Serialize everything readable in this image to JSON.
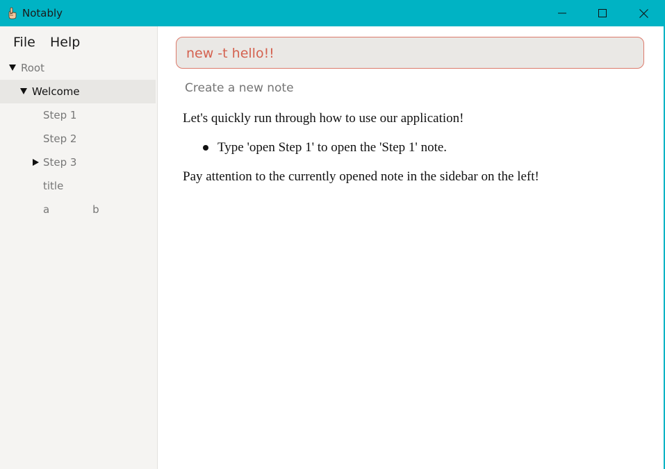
{
  "window": {
    "title": "Notably",
    "app_icon": "hand-pointer-icon",
    "accent_color": "#00b3c4"
  },
  "menu": {
    "file": "File",
    "help": "Help"
  },
  "tree": {
    "root": "Root",
    "welcome": "Welcome",
    "step1": "Step 1",
    "step2": "Step 2",
    "step3": "Step 3",
    "title_item": "title",
    "a_item": "a             b"
  },
  "command": {
    "value": "new -t hello!!",
    "border_color": "#dc7a6b",
    "text_color": "#d4614f"
  },
  "hint": "Create a new note",
  "note": {
    "intro": "Let's quickly run through how to use our application!",
    "bullet1": "Type 'open Step 1' to open the 'Step 1' note.",
    "outro": "Pay attention to the currently opened note in the sidebar on the left!"
  }
}
